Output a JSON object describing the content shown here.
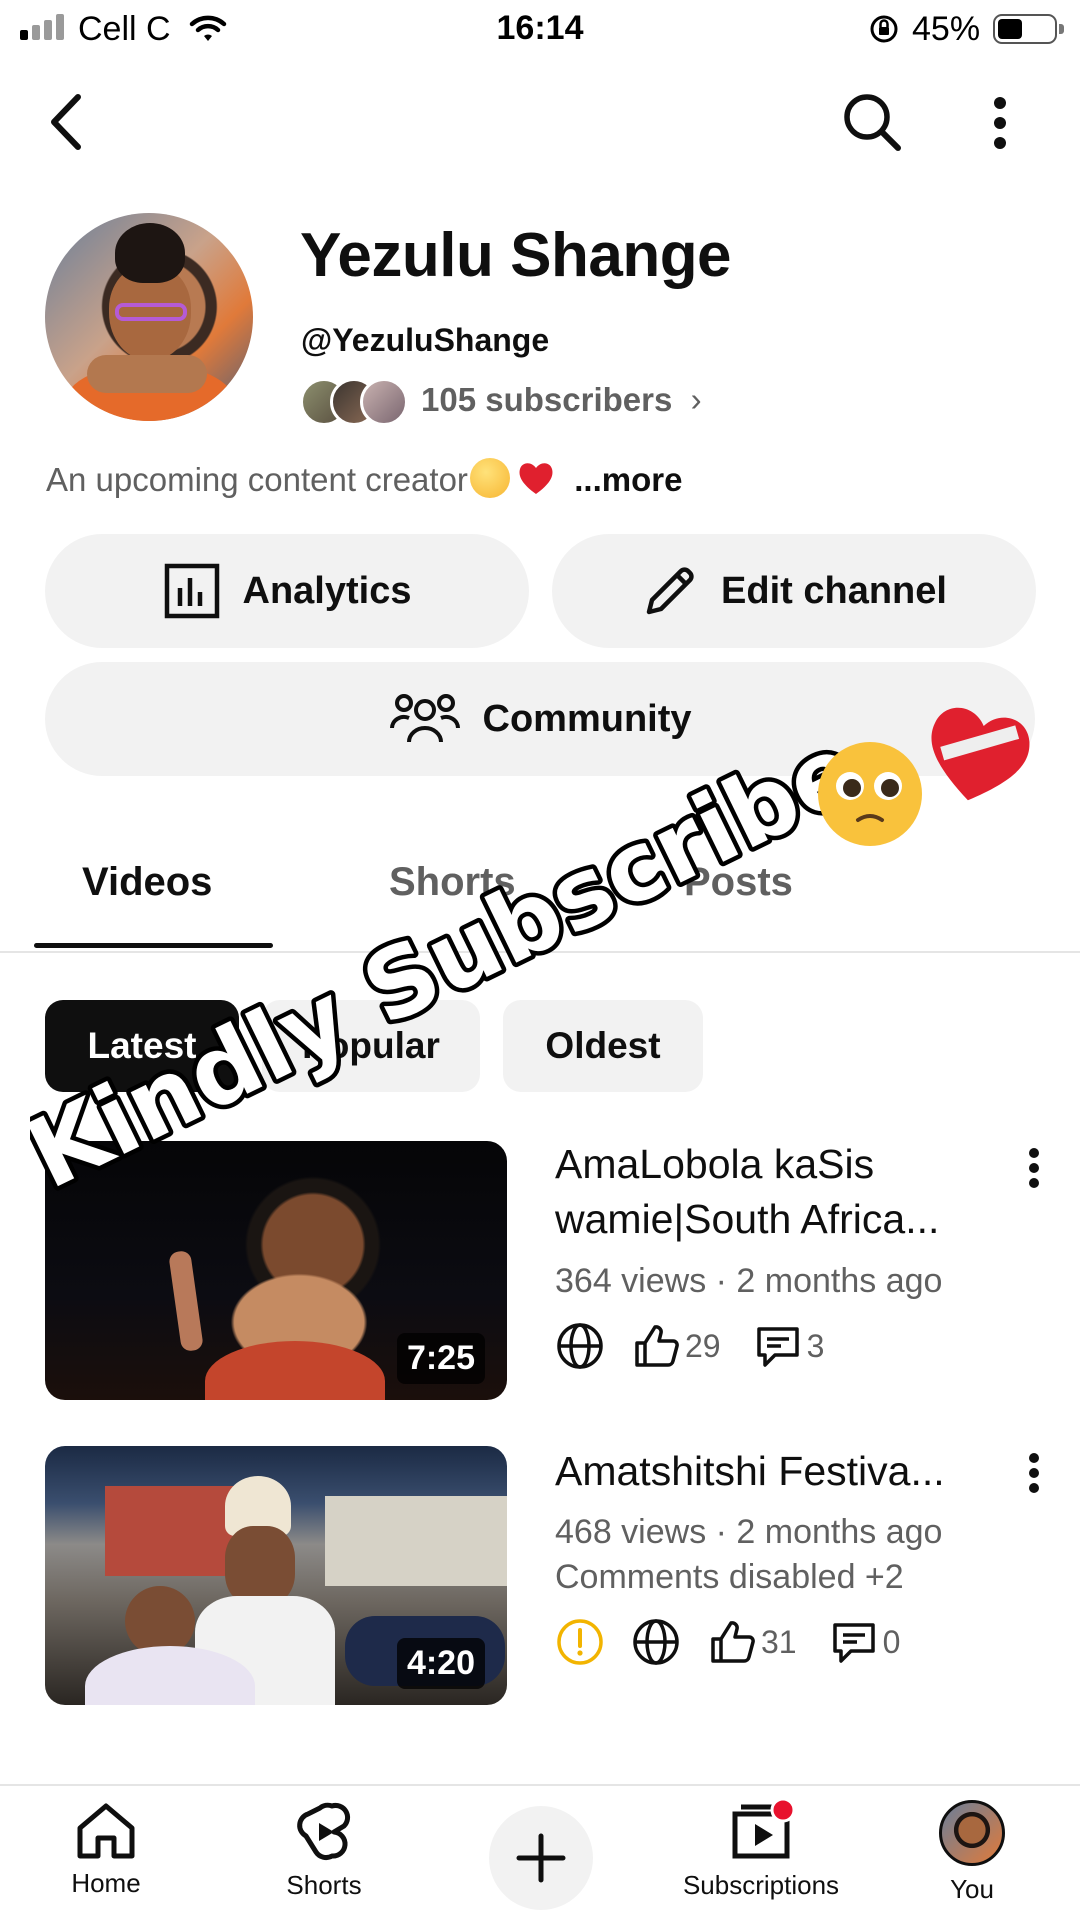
{
  "status_bar": {
    "carrier": "Cell C",
    "time": "16:14",
    "battery_percent": "45%",
    "battery_level": 0.45
  },
  "top_bar": {
    "back_icon": "chevron-left-icon",
    "search_icon": "search-icon",
    "more_icon": "vertical-dots-icon"
  },
  "channel": {
    "name": "Yezulu Shange",
    "handle": "@YezuluShange",
    "subscribers": "105 subscribers",
    "description": "An upcoming content creator",
    "more_label": "...more"
  },
  "actions": {
    "analytics": "Analytics",
    "edit_channel": "Edit channel",
    "community": "Community"
  },
  "tabs": [
    {
      "label": "Videos",
      "active": true
    },
    {
      "label": "Shorts",
      "active": false
    },
    {
      "label": "Posts",
      "active": false
    }
  ],
  "sort_chips": [
    {
      "label": "Latest",
      "active": true
    },
    {
      "label": "Popular",
      "active": false
    },
    {
      "label": "Oldest",
      "active": false
    }
  ],
  "videos": [
    {
      "title": "AmaLobola kaSis wamie|South Africa...",
      "meta": "364 views · 2 months ago",
      "duration": "7:25",
      "likes": "29",
      "comments": "3"
    },
    {
      "title": "Amatshitshi Festiva...",
      "meta": "468 views · 2 months ago",
      "meta2": "Comments disabled +2",
      "duration": "4:20",
      "likes": "31",
      "comments": "0"
    }
  ],
  "overlay_text": "Kindly Subscribe",
  "bottom_nav": [
    {
      "label": "Home",
      "icon": "home-icon"
    },
    {
      "label": "Shorts",
      "icon": "shorts-icon"
    },
    {
      "label": "",
      "icon": "plus-icon"
    },
    {
      "label": "Subscriptions",
      "icon": "subscriptions-icon"
    },
    {
      "label": "You",
      "icon": "avatar"
    }
  ],
  "colors": {
    "text_primary": "#0f0f0f",
    "text_secondary": "#606060",
    "chip_bg": "#f2f2f2",
    "warning": "#f2b400",
    "notification_dot": "#e8112d"
  }
}
